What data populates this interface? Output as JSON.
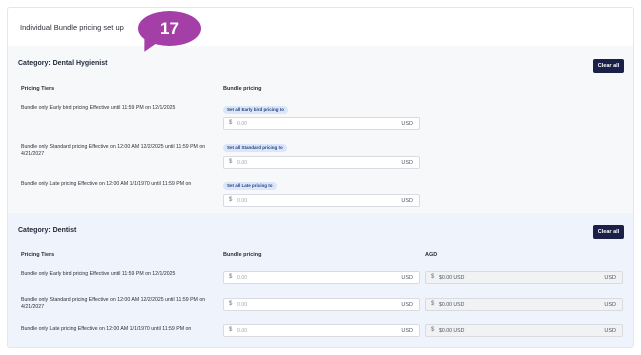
{
  "header": {
    "title": "Individual Bundle pricing set up"
  },
  "step_badge": {
    "number": "17"
  },
  "currency_symbol": "$",
  "sections": [
    {
      "category": "Category: Dental Hygienist",
      "clear_label": "Clear all",
      "columns": {
        "tiers": "Pricing Tiers",
        "bundle": "Bundle pricing"
      },
      "rows": [
        {
          "tier": "Bundle only Early bird pricing Effective until 11:59 PM on 12/1/2025",
          "set_all": "Set all Early bird pricing to",
          "bundle_value": "0.00",
          "unit": "USD"
        },
        {
          "tier": "Bundle only Standard pricing Effective on 12:00 AM 12/2/2025 until 11:59 PM on 4/21/2027",
          "set_all": "Set all Standard pricing to",
          "bundle_value": "0.00",
          "unit": "USD"
        },
        {
          "tier": "Bundle only Late pricing Effective on 12:00 AM 1/1/1970 until 11:59 PM on",
          "set_all": "Set all Late pricing to",
          "bundle_value": "0.00",
          "unit": "USD"
        }
      ]
    },
    {
      "category": "Category: Dentist",
      "clear_label": "Clear all",
      "columns": {
        "tiers": "Pricing Tiers",
        "bundle": "Bundle pricing",
        "agd": "AGD"
      },
      "rows": [
        {
          "tier": "Bundle only Early bird pricing Effective until 11:59 PM on 12/1/2025",
          "bundle_value": "0.00",
          "unit": "USD",
          "agd_value": "$0.00 USD",
          "agd_unit": "USD"
        },
        {
          "tier": "Bundle only Standard pricing Effective on 12:00 AM 12/2/2025 until 11:59 PM on 4/21/2027",
          "bundle_value": "0.00",
          "unit": "USD",
          "agd_value": "$0.00 USD",
          "agd_unit": "USD"
        },
        {
          "tier": "Bundle only Late pricing Effective on 12:00 AM 1/1/1970 until 11:59 PM on",
          "bundle_value": "0.00",
          "unit": "USD",
          "agd_value": "$0.00 USD",
          "agd_unit": "USD"
        }
      ]
    }
  ]
}
